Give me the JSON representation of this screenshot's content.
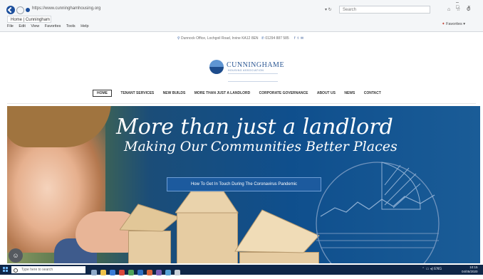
{
  "browser": {
    "url": "https://www.cunninghamhousing.org",
    "search_placeholder": "Search",
    "tab_title": "Home | Cunningham Housing...",
    "menu": [
      "File",
      "Edit",
      "View",
      "Favorites",
      "Tools",
      "Help"
    ],
    "favorites_label": "Favorites",
    "window_controls": [
      "–",
      "□",
      "×"
    ]
  },
  "site": {
    "contact_address": "Dunnock Office, Lochgoil Road, Irvine KA12 8EN",
    "contact_phone": "01294 887 585",
    "logo_name": "CUNNINGHAME",
    "logo_subtitle": "HOUSING ASSOCIATION",
    "nav": [
      "HOME",
      "TENANT SERVICES",
      "NEW BUILDS",
      "MORE THAN JUST A LANDLORD",
      "CORPORATE GOVERNANCE",
      "ABOUT US",
      "NEWS",
      "CONTACT"
    ]
  },
  "hero": {
    "title": "More than just a landlord",
    "subtitle": "Making Our Communities Better Places",
    "button_label": "How To Get In Touch During The Coronavirus Pandemic"
  },
  "taskbar": {
    "search_placeholder": "Type here to search",
    "time": "10:15",
    "date": "04/05/2020"
  },
  "colors": {
    "brand_blue": "#2d5894",
    "hero_blue": "#0f4f8d",
    "button_blue": "#1c5a9e",
    "taskbar": "#0f2647"
  },
  "icons": [
    "back-icon",
    "forward-icon",
    "refresh-icon",
    "home-icon",
    "star-icon",
    "settings-icon",
    "location-pin-icon",
    "phone-icon",
    "facebook-icon",
    "twitter-icon",
    "email-icon",
    "chat-icon",
    "windows-start-icon",
    "search-icon"
  ]
}
